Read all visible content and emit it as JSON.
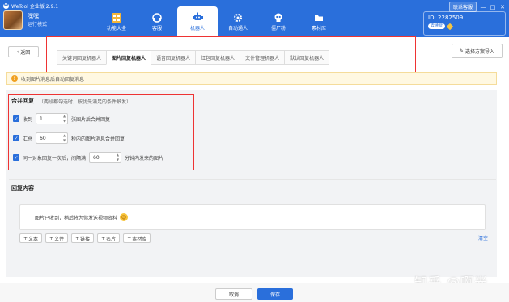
{
  "app": {
    "title": "WeTool 企业版 2.9.1",
    "logo_char": "W"
  },
  "profile": {
    "name": "嘿嘿",
    "status": "运行模式"
  },
  "nav": [
    {
      "label": "功能大全",
      "icon": "grid-icon"
    },
    {
      "label": "客服",
      "icon": "headset-icon"
    },
    {
      "label": "机器人",
      "icon": "robot-icon",
      "active": true
    },
    {
      "label": "自动通人",
      "icon": "gear-icon"
    },
    {
      "label": "僵尸粉",
      "icon": "skull-icon"
    },
    {
      "label": "素材库",
      "icon": "folder-icon"
    }
  ],
  "header_right": {
    "contact": "联系客服",
    "id_label": "ID: 2282509",
    "badge": "去续费"
  },
  "window_controls": {
    "minimize": "—",
    "maximize": "□",
    "close": "✕"
  },
  "back_label": "返回",
  "tabs": [
    "关键词回复机器人",
    "图片回复机器人",
    "语音回复机器人",
    "红包回复机器人",
    "文件管理机器人",
    "默认回复机器人"
  ],
  "active_tab_index": 1,
  "mode_button": "选择方案导入",
  "notice": "收到图片消息后自动回复消息",
  "merge": {
    "title": "合并回复",
    "hint": "（两段都勾选时，按优先满足的条件触发）",
    "rules": [
      {
        "prefix": "收到",
        "value": "1",
        "suffix": "张图片后合并回复"
      },
      {
        "prefix": "汇总",
        "value": "60",
        "suffix": "秒内的图片消息合并回复"
      },
      {
        "prefix": "同一对象回复一次后，间隔满",
        "value": "60",
        "suffix": "分钟内发来的图片"
      }
    ]
  },
  "reply": {
    "title": "回复内容",
    "text": "图片已收到，稍后将为你发送视频资料",
    "add_buttons": [
      "文本",
      "文件",
      "链接",
      "名片",
      "素材库"
    ],
    "clear_label": "清空"
  },
  "footer": {
    "cancel": "取消",
    "save": "保存"
  },
  "watermark": "知乎 @啊光",
  "colors": {
    "primary": "#2a6fdb",
    "highlight_box": "#e33333",
    "notice_bg": "#fff8e1"
  }
}
